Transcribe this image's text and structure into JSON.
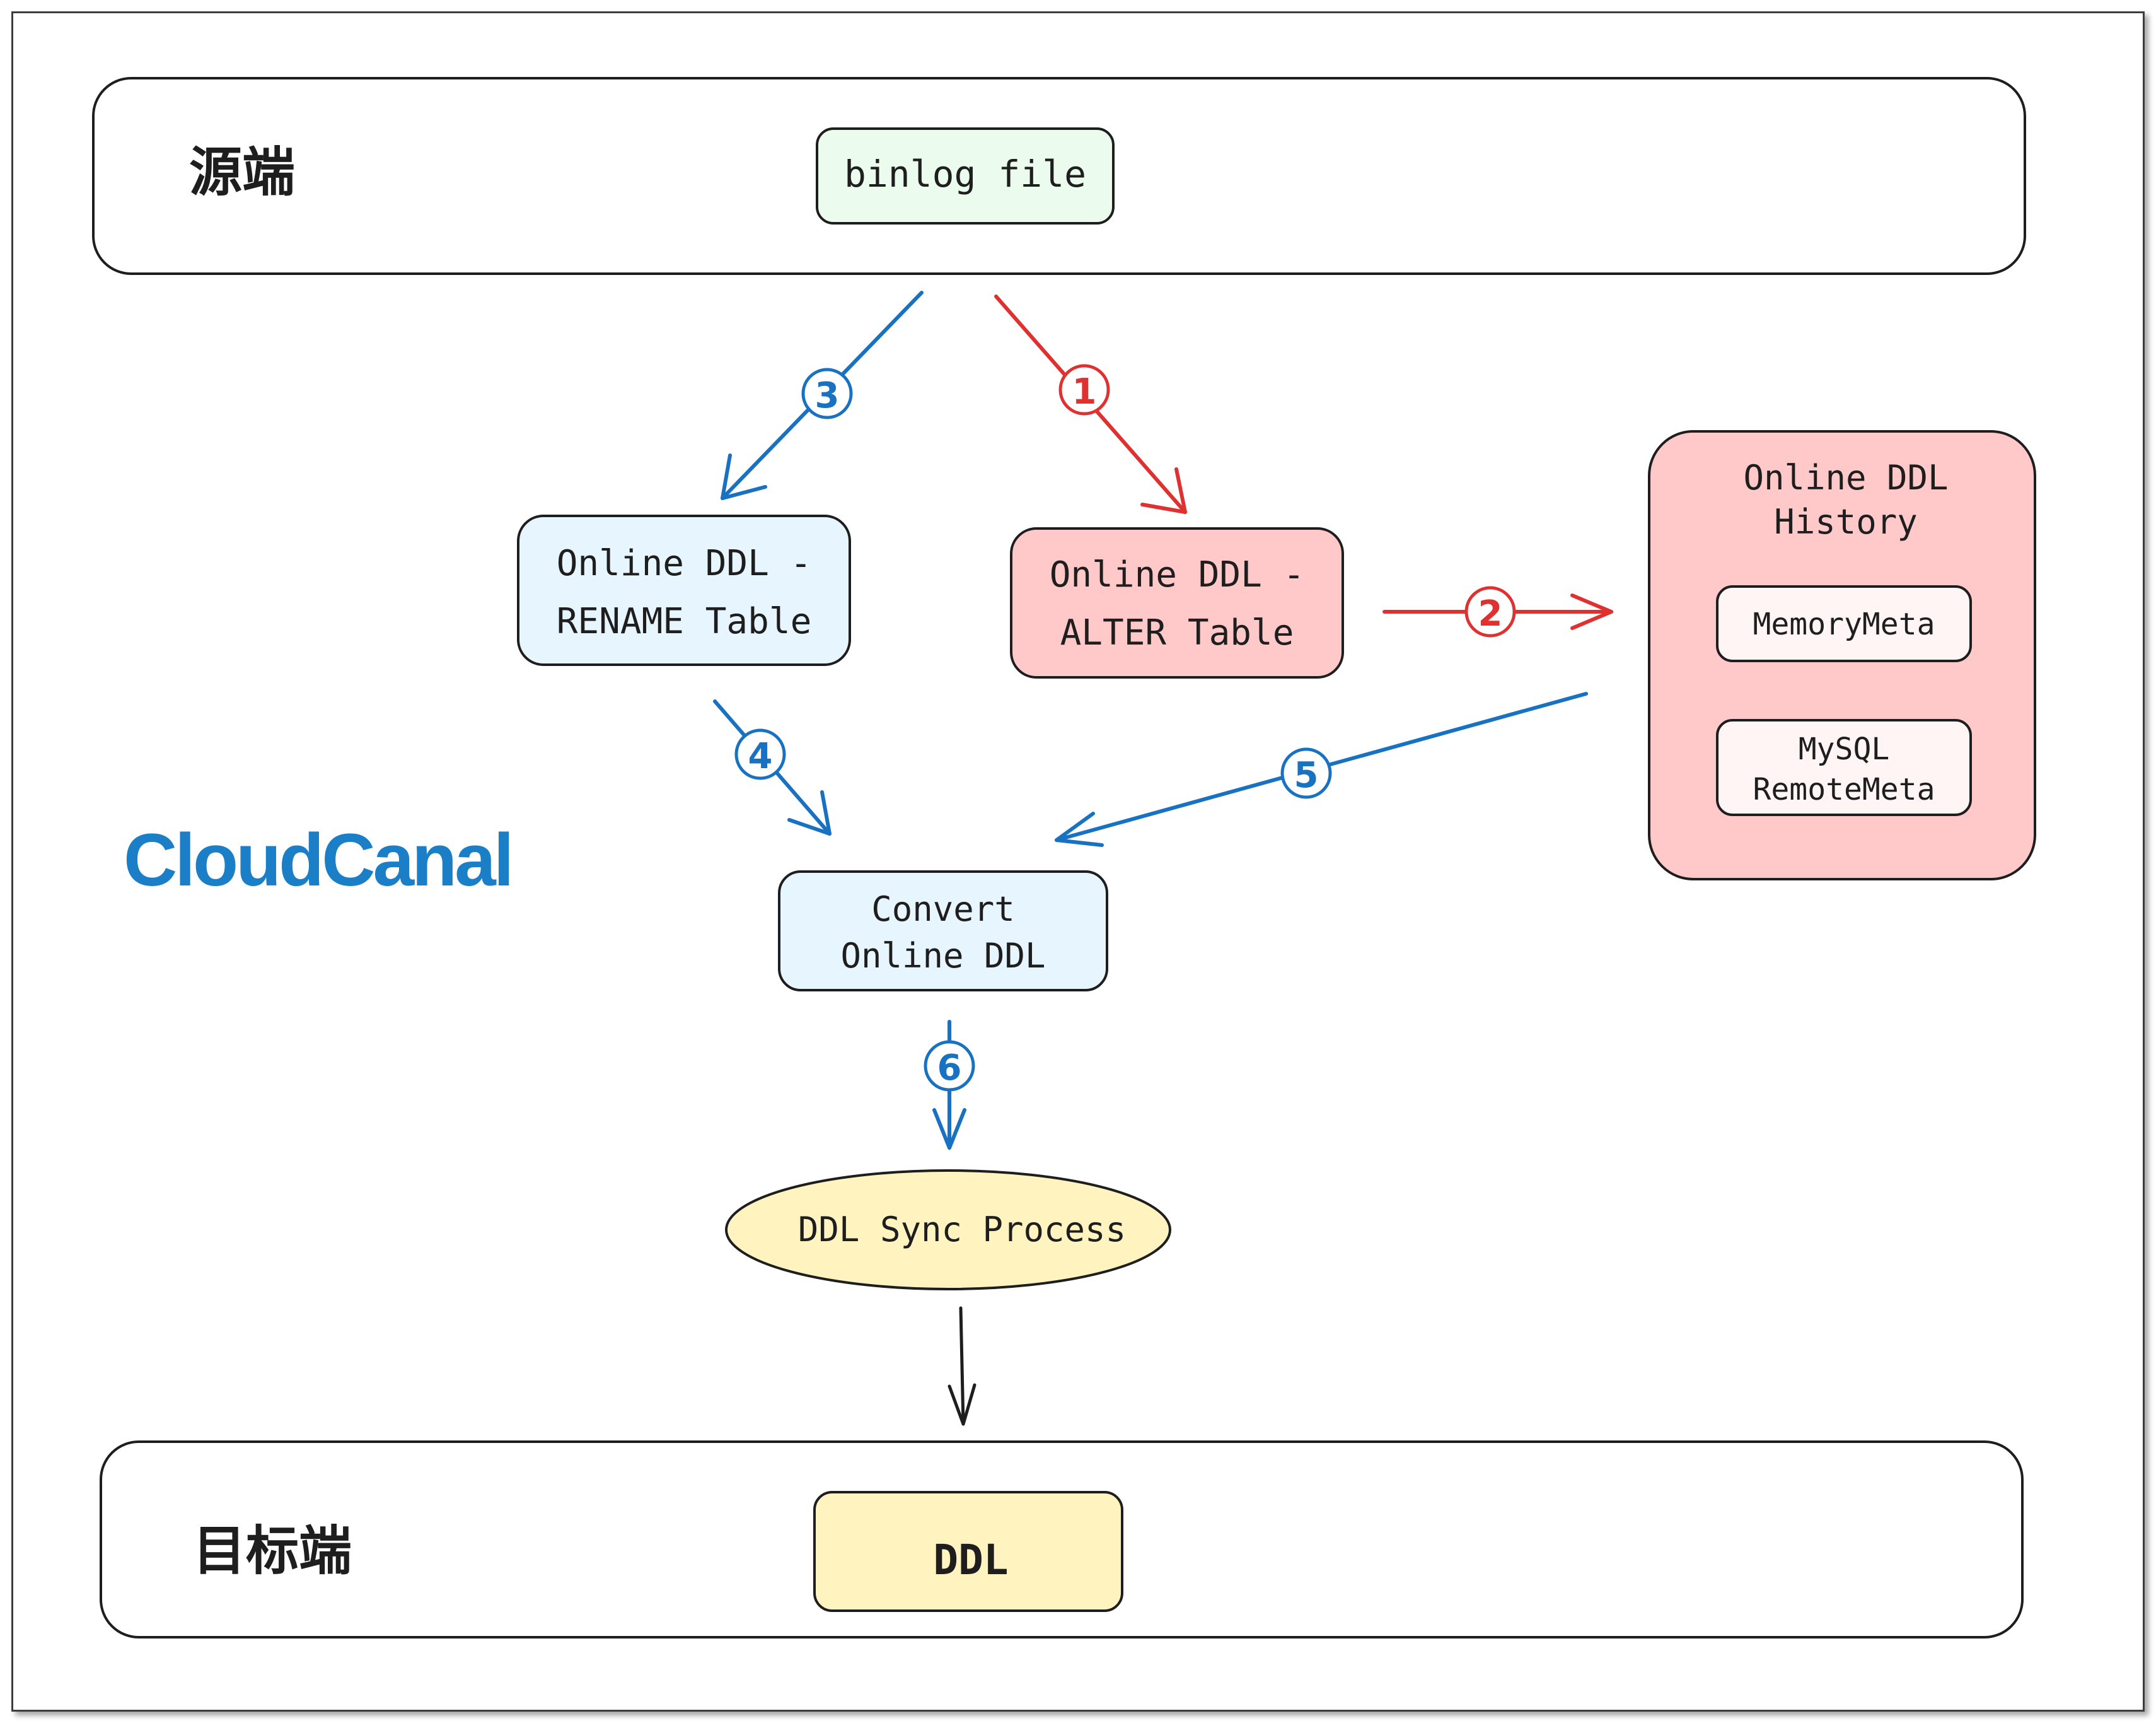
{
  "colors": {
    "blue_flow": "#1971c2",
    "red_flow": "#e03131",
    "green_box": "#ebfbee",
    "blue_box": "#e7f5ff",
    "red_box": "#ffc9c9",
    "yellow_box": "#fff3bf",
    "inner_box": "#fff5f5",
    "logo": "#1b7fc7"
  },
  "source": {
    "title": "源端",
    "binlog": "binlog file"
  },
  "nodes": {
    "rename_l1": "Online DDL -",
    "rename_l2": "RENAME Table",
    "alter_l1": "Online DDL -",
    "alter_l2": "ALTER Table",
    "history_l1": "Online DDL",
    "history_l2": "History",
    "memory_meta": "MemoryMeta",
    "remote_l1": "MySQL",
    "remote_l2": "RemoteMeta",
    "convert_l1": "Convert",
    "convert_l2": "Online DDL",
    "sync_process": "DDL Sync Process"
  },
  "target": {
    "title": "目标端",
    "ddl": "DDL"
  },
  "steps": {
    "s1": "1",
    "s2": "2",
    "s3": "3",
    "s4": "4",
    "s5": "5",
    "s6": "6"
  },
  "logo": {
    "part1": "Cloud",
    "part2": "Canal"
  }
}
